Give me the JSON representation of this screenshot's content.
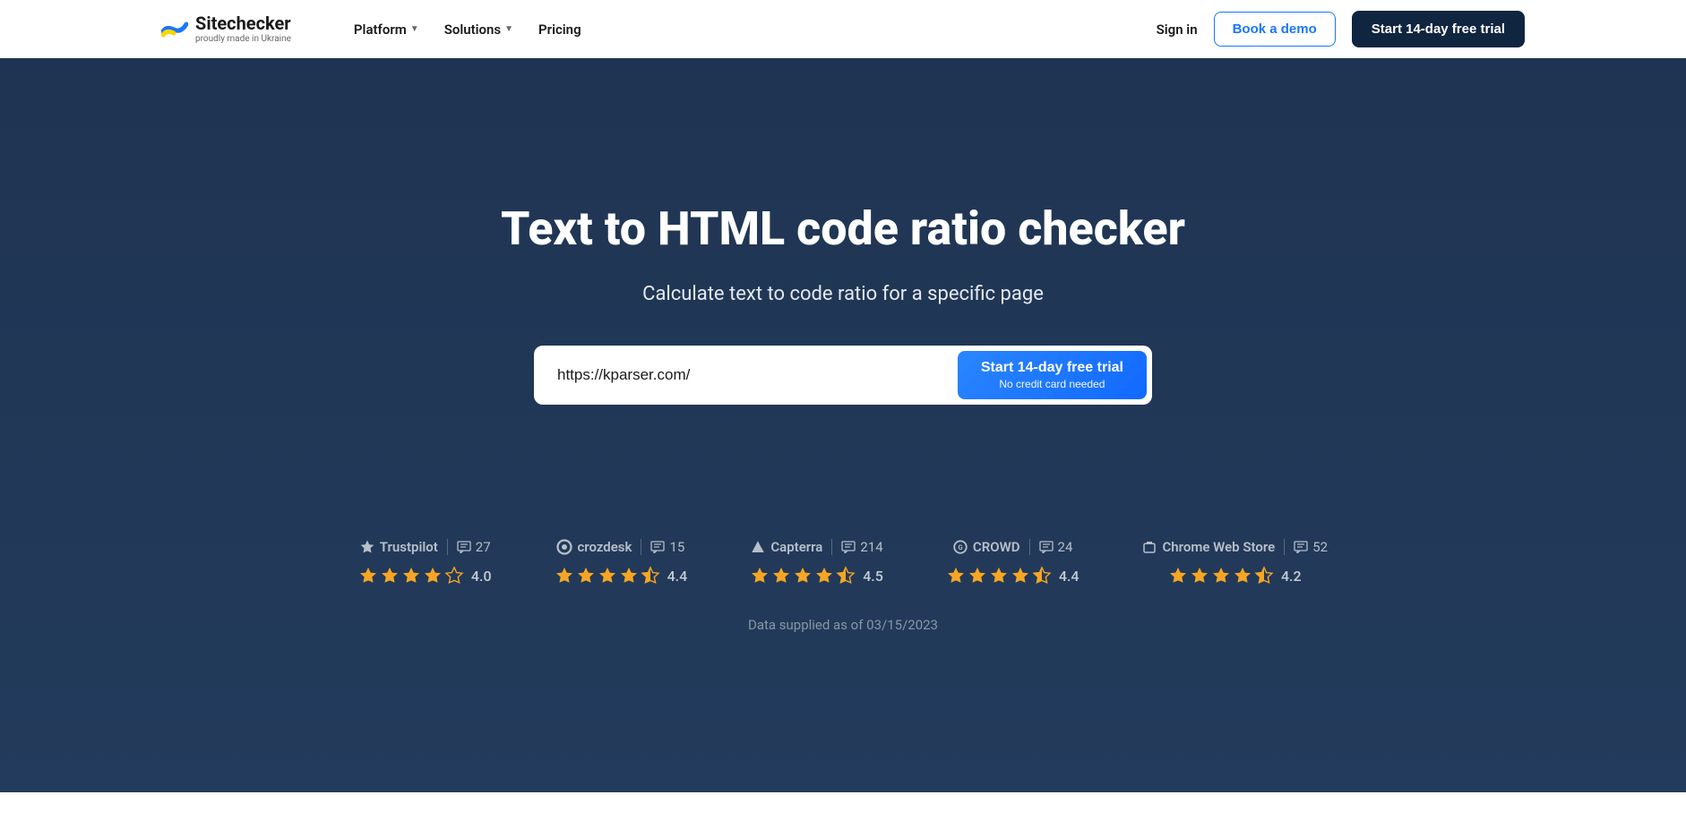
{
  "header": {
    "logo_title": "Sitechecker",
    "logo_sub": "proudly made in Ukraine",
    "nav": [
      {
        "label": "Platform",
        "dropdown": true
      },
      {
        "label": "Solutions",
        "dropdown": true
      },
      {
        "label": "Pricing",
        "dropdown": false
      }
    ],
    "signin": "Sign in",
    "book_demo": "Book a demo",
    "trial": "Start 14-day free trial"
  },
  "hero": {
    "title": "Text to HTML code ratio checker",
    "subtitle": "Calculate text to code ratio for a specific page",
    "input_value": "https://kparser.com/",
    "cta_line1": "Start 14-day free trial",
    "cta_line2": "No credit card needed"
  },
  "reviews": [
    {
      "platform": "Trustpilot",
      "count": "27",
      "rating": "4.0",
      "stars": 4.0
    },
    {
      "platform": "crozdesk",
      "count": "15",
      "rating": "4.4",
      "stars": 4.5
    },
    {
      "platform": "Capterra",
      "count": "214",
      "rating": "4.5",
      "stars": 4.5
    },
    {
      "platform": "CROWD",
      "count": "24",
      "rating": "4.4",
      "stars": 4.5
    },
    {
      "platform": "Chrome Web Store",
      "count": "52",
      "rating": "4.2",
      "stars": 4.5
    }
  ],
  "data_date": "Data supplied as of 03/15/2023"
}
